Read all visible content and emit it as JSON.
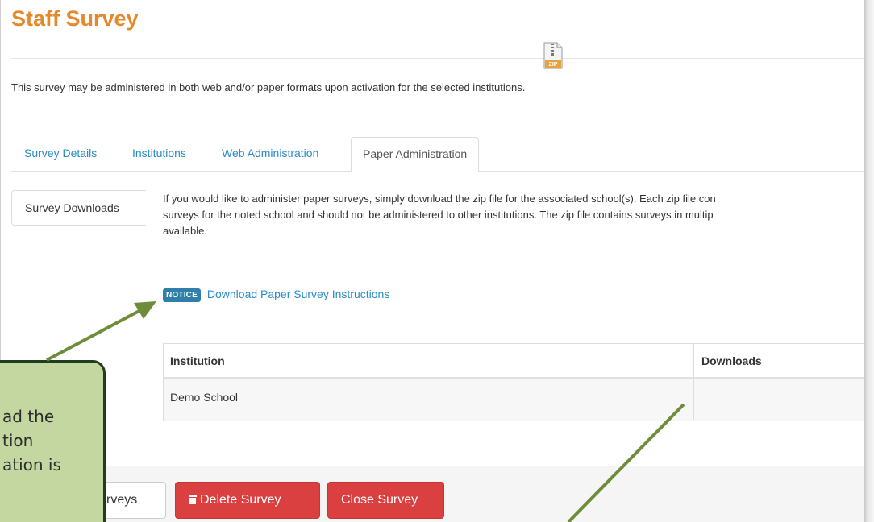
{
  "page": {
    "title": "Staff Survey",
    "intro": "This survey may be administered in both web and/or paper formats upon activation for the selected institutions."
  },
  "tabs": [
    {
      "label": "Survey Details",
      "active": false
    },
    {
      "label": "Institutions",
      "active": false
    },
    {
      "label": "Web Administration",
      "active": false
    },
    {
      "label": "Paper Administration",
      "active": true
    }
  ],
  "side_nav": {
    "active_label": "Survey Downloads"
  },
  "description_lines": [
    "If you would like to administer paper surveys, simply download the zip file for the associated school(s). Each zip file con",
    "surveys for the noted school and should not be administered to other institutions. The zip file contains surveys in multip",
    "available."
  ],
  "notice": {
    "badge": "NOTICE",
    "link": "Download Paper Survey Instructions"
  },
  "table": {
    "headers": [
      "Institution",
      "Downloads"
    ],
    "rows": [
      {
        "institution": "Demo School",
        "download_icon": "zip-file-icon"
      }
    ]
  },
  "zip_icon_label": "ZIP",
  "footer_buttons": {
    "surveys": "rveys",
    "delete": "Delete Survey",
    "delete_icon": "trash-icon",
    "close": "Close Survey"
  },
  "callout": {
    "lines": [
      "ad the",
      "tion",
      "ation is"
    ]
  },
  "colors": {
    "title": "#e48a2c",
    "link": "#2a8cc7",
    "badge": "#2f7fa9",
    "danger": "#d9403f",
    "callout_fill": "#c5d7a0",
    "callout_border": "#1f3e1f",
    "arrow": "#6e8d3a"
  }
}
